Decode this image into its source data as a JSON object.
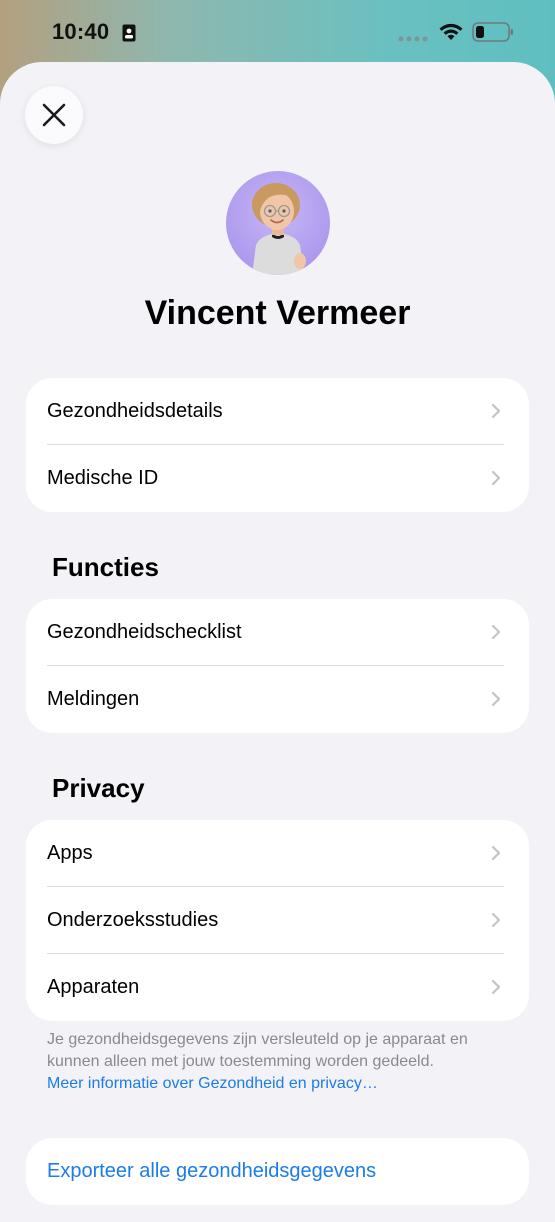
{
  "status": {
    "time": "10:40"
  },
  "profile": {
    "name": "Vincent Vermeer"
  },
  "groups": {
    "main": [
      {
        "label": "Gezondheidsdetails"
      },
      {
        "label": "Medische ID"
      }
    ],
    "functions": {
      "title": "Functies",
      "items": [
        {
          "label": "Gezondheidschecklist"
        },
        {
          "label": "Meldingen"
        }
      ]
    },
    "privacy": {
      "title": "Privacy",
      "items": [
        {
          "label": "Apps"
        },
        {
          "label": "Onderzoeksstudies"
        },
        {
          "label": "Apparaten"
        }
      ],
      "footnote": "Je gezondheidsgegevens zijn versleuteld op je apparaat en kunnen alleen met jouw toestemming worden gedeeld.",
      "footnote_link": "Meer informatie over Gezondheid en privacy…"
    }
  },
  "export": {
    "label": "Exporteer alle gezondheidsgegevens"
  },
  "colors": {
    "accent": "#1c7ce8",
    "background": "#f2f2f7",
    "avatar_bg": "#b8a6f2"
  },
  "icons": {
    "close": "close-icon",
    "chevron": "chevron-right-icon",
    "wifi": "wifi-icon",
    "battery": "battery-icon",
    "id": "id-badge-icon"
  }
}
